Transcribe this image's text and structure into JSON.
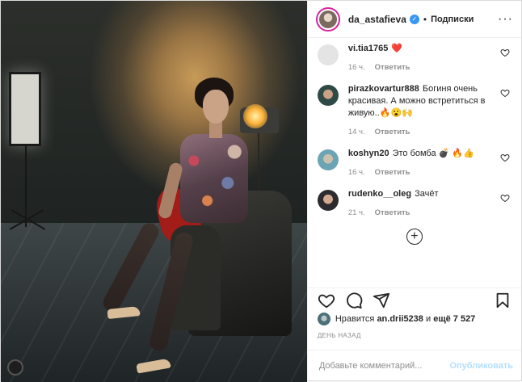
{
  "header": {
    "username": "da_astafieva",
    "verified_symbol": "✓",
    "separator": "•",
    "follow_label": "Подписки",
    "more_symbol": "···"
  },
  "comments": [
    {
      "user": "vi.tia1765",
      "text": "❤️",
      "time": "16 ч.",
      "reply": "Ответить"
    },
    {
      "user": "pirazkovartur888",
      "text": "Богиня очень красивая. А можно встретиться в живую..🔥😮🙌",
      "time": "14 ч.",
      "reply": "Ответить"
    },
    {
      "user": "koshyn20",
      "text": "Это бомба 💣 🔥👍",
      "time": "16 ч.",
      "reply": "Ответить"
    },
    {
      "user": "rudenko__oleg",
      "text": "Зачёт",
      "time": "21 ч.",
      "reply": "Ответить"
    }
  ],
  "load_more_symbol": "+",
  "likes": {
    "prefix": "Нравится",
    "user": "an.drii5238",
    "middle": "и",
    "count": "ещё 7 527"
  },
  "date": "ДЕНЬ НАЗАД",
  "add_comment": {
    "placeholder": "Добавьте комментарий...",
    "publish_label": "Опубликовать"
  },
  "icons": {
    "heart": "heart-icon",
    "comment": "comment-icon",
    "share": "share-icon",
    "save": "bookmark-icon"
  },
  "colors": {
    "verified": "#3897f0",
    "publish_disabled": "#b2dffc",
    "muted": "#8e8e8e"
  }
}
